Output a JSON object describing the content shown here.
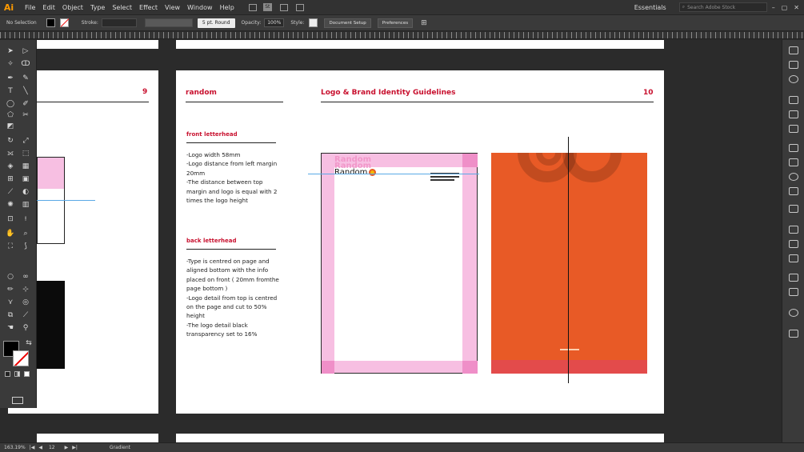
{
  "menubar": {
    "app_logo": "Ai",
    "items": [
      "File",
      "Edit",
      "Object",
      "Type",
      "Select",
      "Effect",
      "View",
      "Window",
      "Help"
    ],
    "bridge_label": "St",
    "workspace": "Essentials",
    "search_placeholder": "Search Adobe Stock"
  },
  "controlbar": {
    "selection": "No Selection",
    "stroke_label": "Stroke:",
    "brush": "5 pt. Round",
    "opacity_label": "Opacity:",
    "opacity_value": "100%",
    "style_label": "Style:",
    "document_setup": "Document Setup",
    "preferences": "Preferences"
  },
  "artboard_left": {
    "page_number": "9"
  },
  "artboard_main": {
    "brand": "random",
    "header_title": "Logo & Brand Identity Guidelines",
    "page_number": "10",
    "front_title": "front letterhead",
    "front_text": "-Logo width 58mm\n-Logo distance from left margin 20mm\n-The distance between top margin and logo is equal with 2 times the logo height",
    "back_title": "back letterhead",
    "back_text": "-Type is centred on page and aligned bottom with the info placed on front ( 20mm fromthe page bottom )\n-Logo detail from top is centred on the page and cut to 50% height\n-The logo detail black transparency set to 16%",
    "logo_word": "Random",
    "colors": {
      "accent": "#c8102e",
      "pink": "#f7bfe2",
      "orange": "#e85a26"
    }
  },
  "statusbar": {
    "zoom": "163.19%",
    "artboard_number": "12",
    "tool": "Gradient"
  }
}
